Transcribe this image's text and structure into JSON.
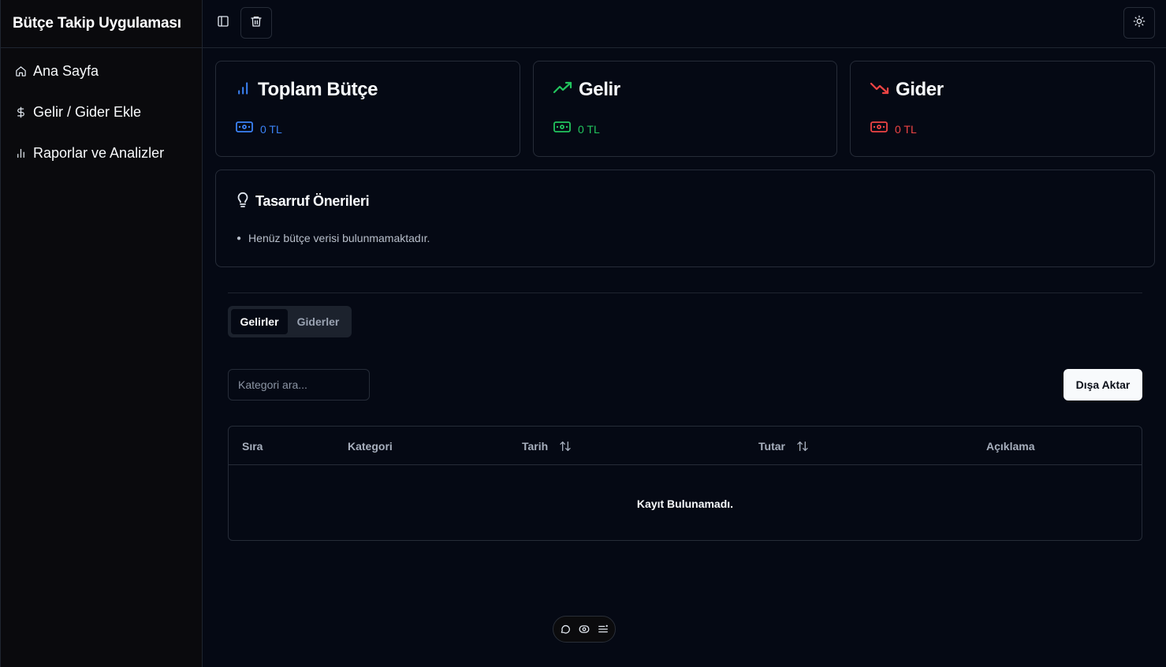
{
  "app": {
    "title": "Bütçe Takip Uygulaması"
  },
  "sidebar": {
    "items": [
      {
        "label": "Ana Sayfa",
        "icon": "home-icon"
      },
      {
        "label": "Gelir / Gider Ekle",
        "icon": "dollar-icon"
      },
      {
        "label": "Raporlar ve Analizler",
        "icon": "bar-chart-icon"
      }
    ]
  },
  "topbar": {
    "icons": [
      "sidebar-toggle-icon",
      "trash-icon",
      "sun-icon"
    ]
  },
  "stats": [
    {
      "title": "Toplam Bütçe",
      "value": "0 TL",
      "color": "#3b82f6",
      "icon": "bar-chart-icon"
    },
    {
      "title": "Gelir",
      "value": "0 TL",
      "color": "#22c55e",
      "icon": "trending-up-icon"
    },
    {
      "title": "Gider",
      "value": "0 TL",
      "color": "#ef4444",
      "icon": "trending-down-icon"
    }
  ],
  "tips": {
    "title": "Tasarruf Önerileri",
    "items": [
      "Henüz bütçe verisi bulunmamaktadır."
    ]
  },
  "tabs": [
    {
      "label": "Gelirler",
      "active": true
    },
    {
      "label": "Giderler",
      "active": false
    }
  ],
  "search": {
    "placeholder": "Kategori ara...",
    "value": ""
  },
  "export": {
    "label": "Dışa Aktar"
  },
  "table": {
    "columns": [
      "Sıra",
      "Kategori",
      "Tarih",
      "Tutar",
      "Açıklama"
    ],
    "empty_text": "Kayıt Bulunamadı."
  },
  "floating_toolbar": {
    "icons": [
      "comment-icon",
      "eye-icon",
      "menu-icon"
    ]
  }
}
